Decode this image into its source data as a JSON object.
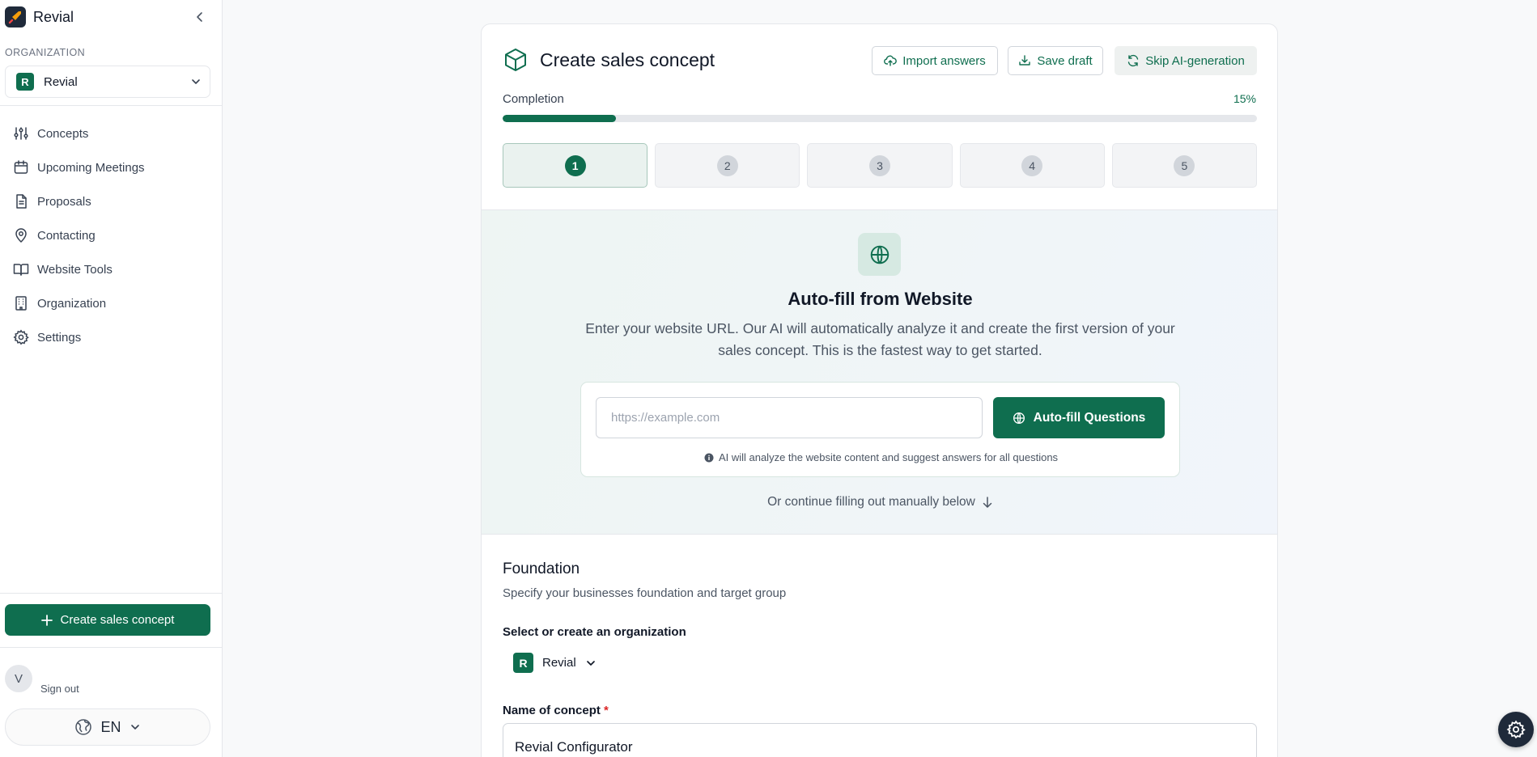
{
  "brand": {
    "name": "Revial"
  },
  "sidebar": {
    "org_section_label": "ORGANIZATION",
    "org_selected": {
      "initial": "R",
      "name": "Revial"
    },
    "nav": [
      {
        "label": "Concepts",
        "icon": "sliders-icon"
      },
      {
        "label": "Upcoming Meetings",
        "icon": "calendar-icon"
      },
      {
        "label": "Proposals",
        "icon": "document-icon"
      },
      {
        "label": "Contacting",
        "icon": "map-pin-icon"
      },
      {
        "label": "Website Tools",
        "icon": "book-open-icon"
      },
      {
        "label": "Organization",
        "icon": "building-icon"
      },
      {
        "label": "Settings",
        "icon": "gear-icon"
      }
    ],
    "create_button": "Create sales concept",
    "user": {
      "initial": "V",
      "sign_out": "Sign out"
    },
    "language": "EN"
  },
  "page": {
    "title": "Create sales concept",
    "buttons": {
      "import": "Import answers",
      "save": "Save draft",
      "skip": "Skip AI-generation"
    },
    "completion": {
      "label": "Completion",
      "percent_text": "15%",
      "percent": 15
    },
    "steps": [
      {
        "number": "1",
        "active": true
      },
      {
        "number": "2",
        "active": false
      },
      {
        "number": "3",
        "active": false
      },
      {
        "number": "4",
        "active": false
      },
      {
        "number": "5",
        "active": false
      }
    ]
  },
  "autofill": {
    "title": "Auto-fill from Website",
    "description": "Enter your website URL. Our AI will automatically analyze it and create the first version of your sales concept. This is the fastest way to get started.",
    "url_placeholder": "https://example.com",
    "url_value": "",
    "button": "Auto-fill Questions",
    "hint": "AI will analyze the website content and suggest answers for all questions",
    "manual": "Or continue filling out manually below"
  },
  "foundation": {
    "title": "Foundation",
    "subtitle": "Specify your businesses foundation and target group",
    "org_label": "Select or create an organization",
    "org_selected": {
      "initial": "R",
      "name": "Revial"
    },
    "name_label": "Name of concept",
    "required_mark": "*",
    "name_value": "Revial Configurator"
  },
  "colors": {
    "accent": "#0f6e4f",
    "accent_light": "#d6e9e2",
    "dark": "#1f2a3a"
  }
}
